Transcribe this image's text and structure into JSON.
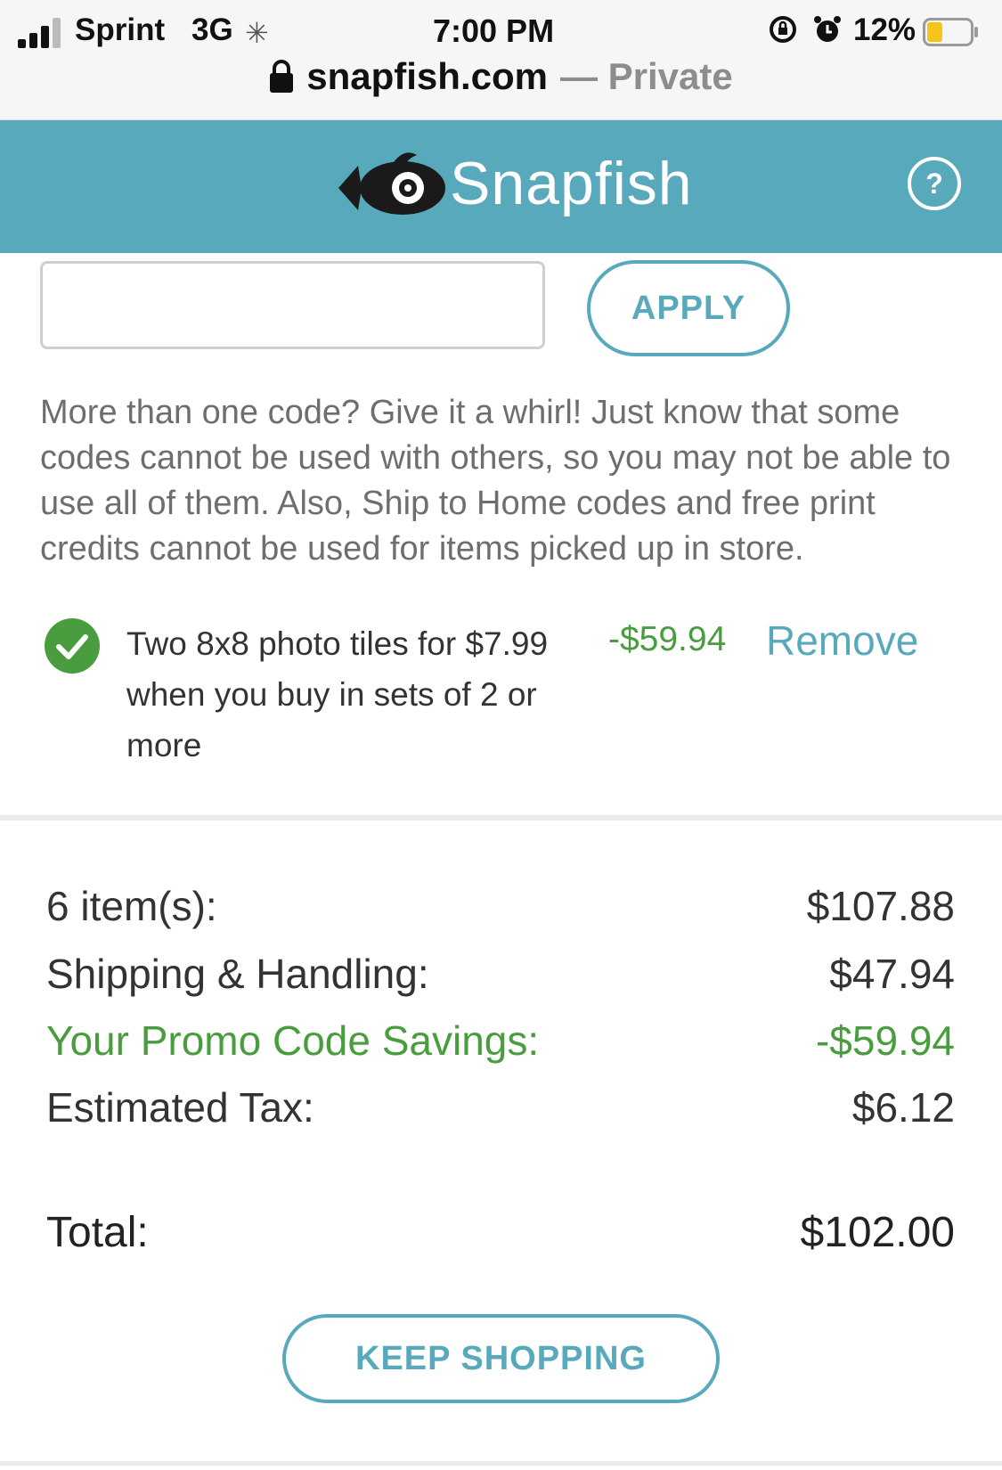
{
  "status_bar": {
    "carrier": "Sprint",
    "network": "3G",
    "activity_icon": "loading-spinner-icon",
    "time": "7:00 PM",
    "battery_percent": "12%",
    "battery_level": 0.12,
    "battery_color": "#f5c518"
  },
  "browser": {
    "url": "snapfish.com",
    "mode": "— Private"
  },
  "header": {
    "brand": "Snapfish",
    "brand_color": "#58a9bb",
    "help_label": "?"
  },
  "promo": {
    "input_value": "",
    "apply_label": "APPLY",
    "helper_text": "More than one code? Give it a whirl! Just know that some codes cannot be used with others, so you may not be able to use all of them. Also, Ship to Home codes and free print credits cannot be used for items picked up in store.",
    "applied": {
      "description": "Two 8x8 photo tiles for $7.99 when you buy in sets of 2 or more",
      "amount": "-$59.94",
      "remove_label": "Remove",
      "status_color": "#4a9d3f"
    }
  },
  "summary": {
    "items_label": "6 item(s):",
    "items_value": "$107.88",
    "shipping_label": "Shipping & Handling:",
    "shipping_value": "$47.94",
    "savings_label": "Your Promo Code Savings:",
    "savings_value": "-$59.94",
    "tax_label": "Estimated Tax:",
    "tax_value": "$6.12",
    "total_label": "Total:",
    "total_value": "$102.00"
  },
  "actions": {
    "keep_shopping_label": "KEEP SHOPPING"
  }
}
